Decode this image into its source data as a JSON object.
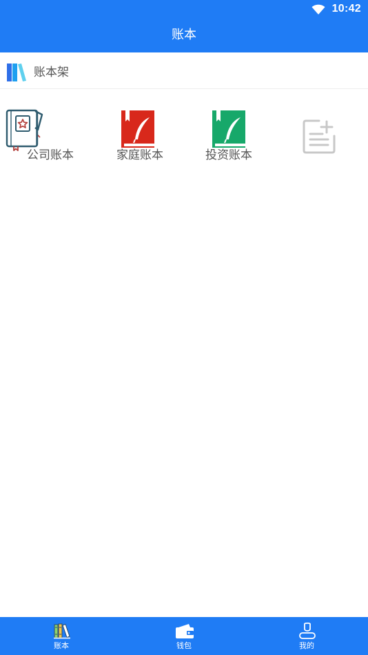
{
  "status_bar": {
    "time": "10:42",
    "wifi_icon": "wifi-icon"
  },
  "app_bar": {
    "title": "账本"
  },
  "shelf": {
    "title": "账本架",
    "icon": "bookshelf-icon"
  },
  "books": [
    {
      "label": "公司账本",
      "icon": "company-ledger-icon",
      "color": "#2e5b6e",
      "accent": "#b3403c"
    },
    {
      "label": "家庭账本",
      "icon": "feather-book-icon",
      "color": "#d8281b"
    },
    {
      "label": "投资账本",
      "icon": "feather-book-icon",
      "color": "#17a86a"
    }
  ],
  "add_book": {
    "icon": "add-note-icon",
    "color": "#c8c8c8"
  },
  "bottom_nav": [
    {
      "label": "账本",
      "icon": "books-icon",
      "selected": true
    },
    {
      "label": "钱包",
      "icon": "wallet-icon",
      "selected": false
    },
    {
      "label": "我的",
      "icon": "user-icon",
      "selected": false
    }
  ],
  "colors": {
    "primary": "#1f7cf5",
    "text_secondary": "#555555",
    "background": "#ffffff"
  }
}
